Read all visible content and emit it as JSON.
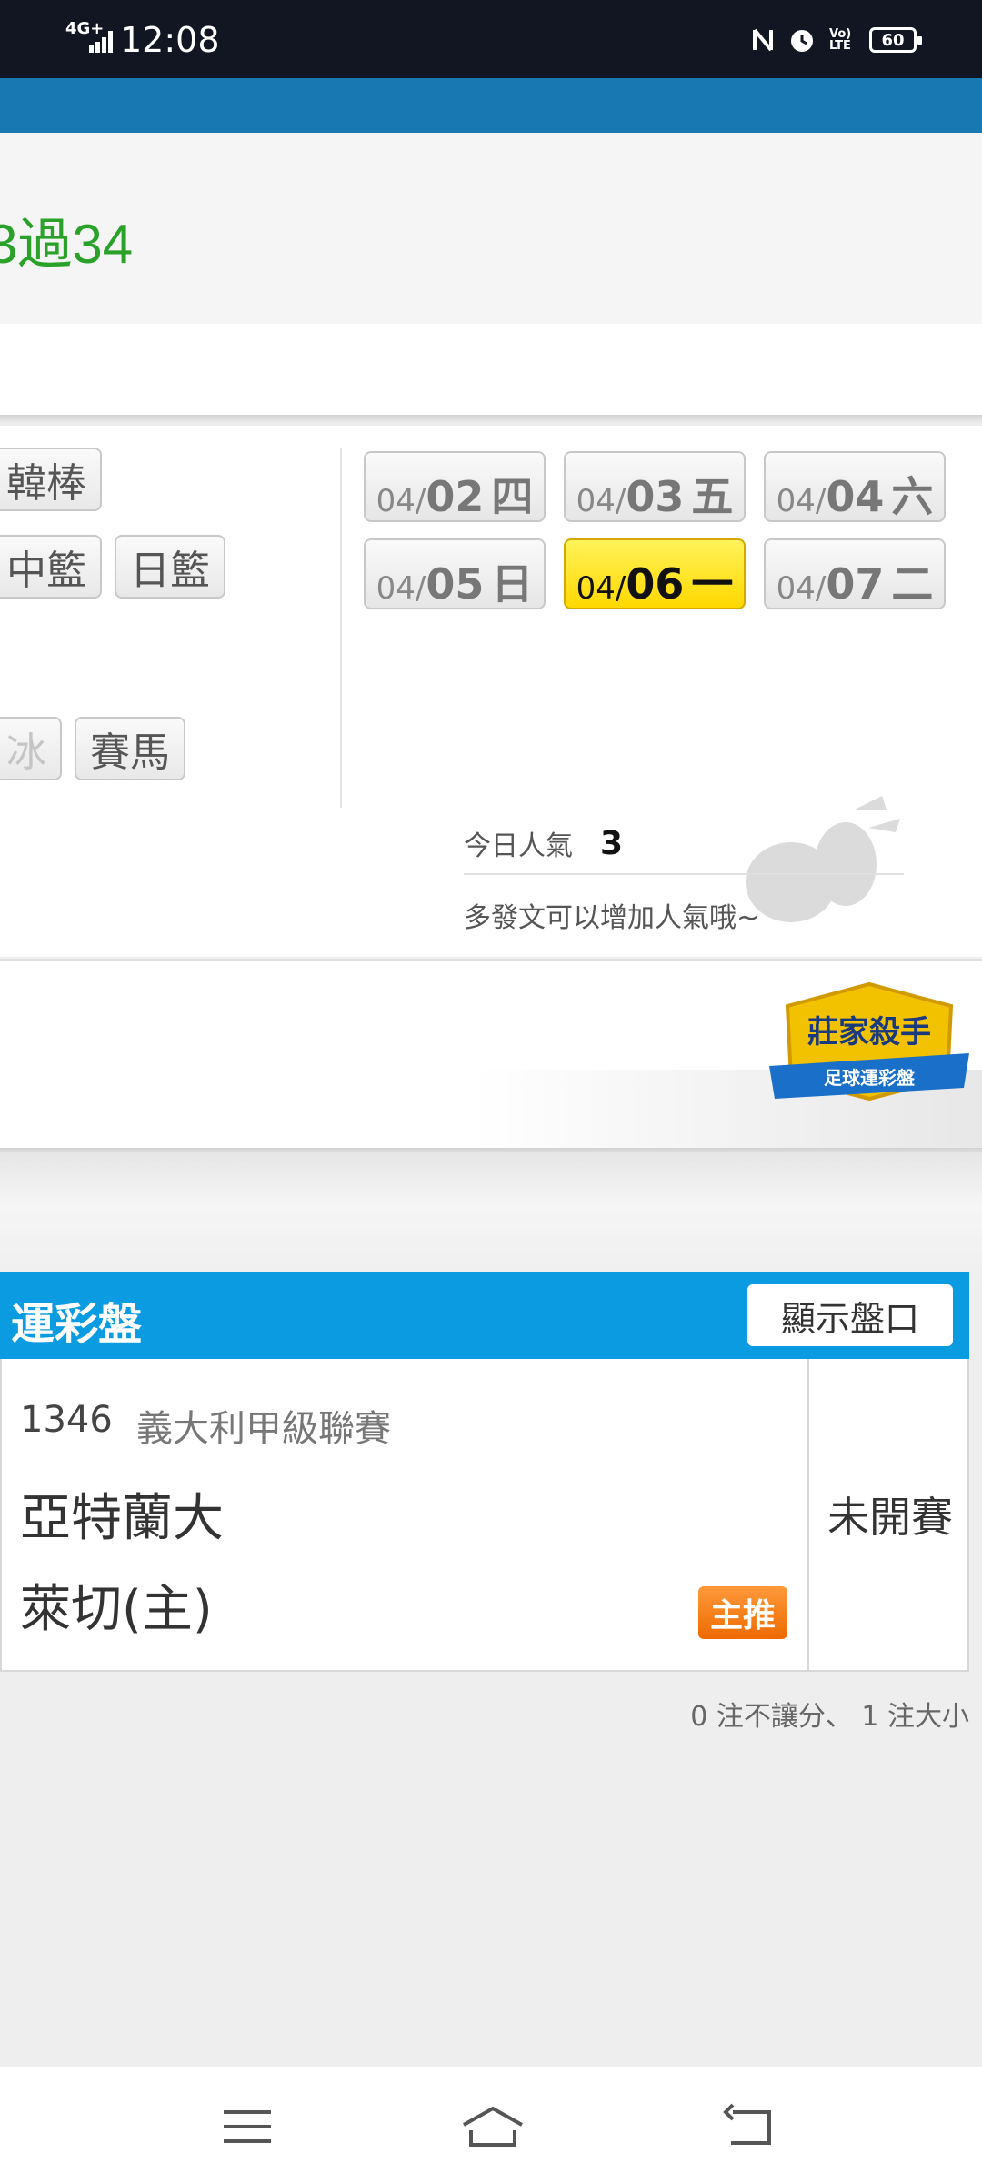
{
  "status_bar": {
    "network": "4G+",
    "time": "12:08",
    "volte": "Vo) LTE",
    "battery": "60",
    "icons": [
      "nfc-icon",
      "alarm-icon",
      "volte-icon",
      "battery-icon"
    ]
  },
  "header": {
    "title_fragment": "3過34"
  },
  "sport_filters": {
    "row1": [
      "韓棒"
    ],
    "row2": [
      "中籃",
      "日籃"
    ],
    "row3_faded": "冰",
    "row3": [
      "賽馬"
    ]
  },
  "dates": [
    {
      "md": "04/",
      "dd": "02",
      "wd": "四",
      "active": false
    },
    {
      "md": "04/",
      "dd": "03",
      "wd": "五",
      "active": false
    },
    {
      "md": "04/",
      "dd": "04",
      "wd": "六",
      "active": false
    },
    {
      "md": "04/",
      "dd": "05",
      "wd": "日",
      "active": false
    },
    {
      "md": "04/",
      "dd": "06",
      "wd": "一",
      "active": true
    },
    {
      "md": "04/",
      "dd": "07",
      "wd": "二",
      "active": false
    }
  ],
  "popularity": {
    "label": "今日人氣",
    "value": "3",
    "hint": "多發文可以增加人氣哦~"
  },
  "banner": {
    "badge_title": "莊家殺手",
    "badge_subtitle": "足球運彩盤"
  },
  "section": {
    "title": "運彩盤",
    "button": "顯示盤口"
  },
  "match": {
    "id": "1346",
    "league": "義大利甲級聯賽",
    "team_away": "亞特蘭大",
    "team_home": "萊切(主)",
    "pick_badge": "主推",
    "status": "未開賽"
  },
  "bet_summary": "0 注不讓分、 1 注大小",
  "colors": {
    "header_green": "#2aa22a",
    "section_blue": "#0a9be0",
    "active_date_yellow": "#ffde00",
    "pick_orange": "#f07a10"
  }
}
